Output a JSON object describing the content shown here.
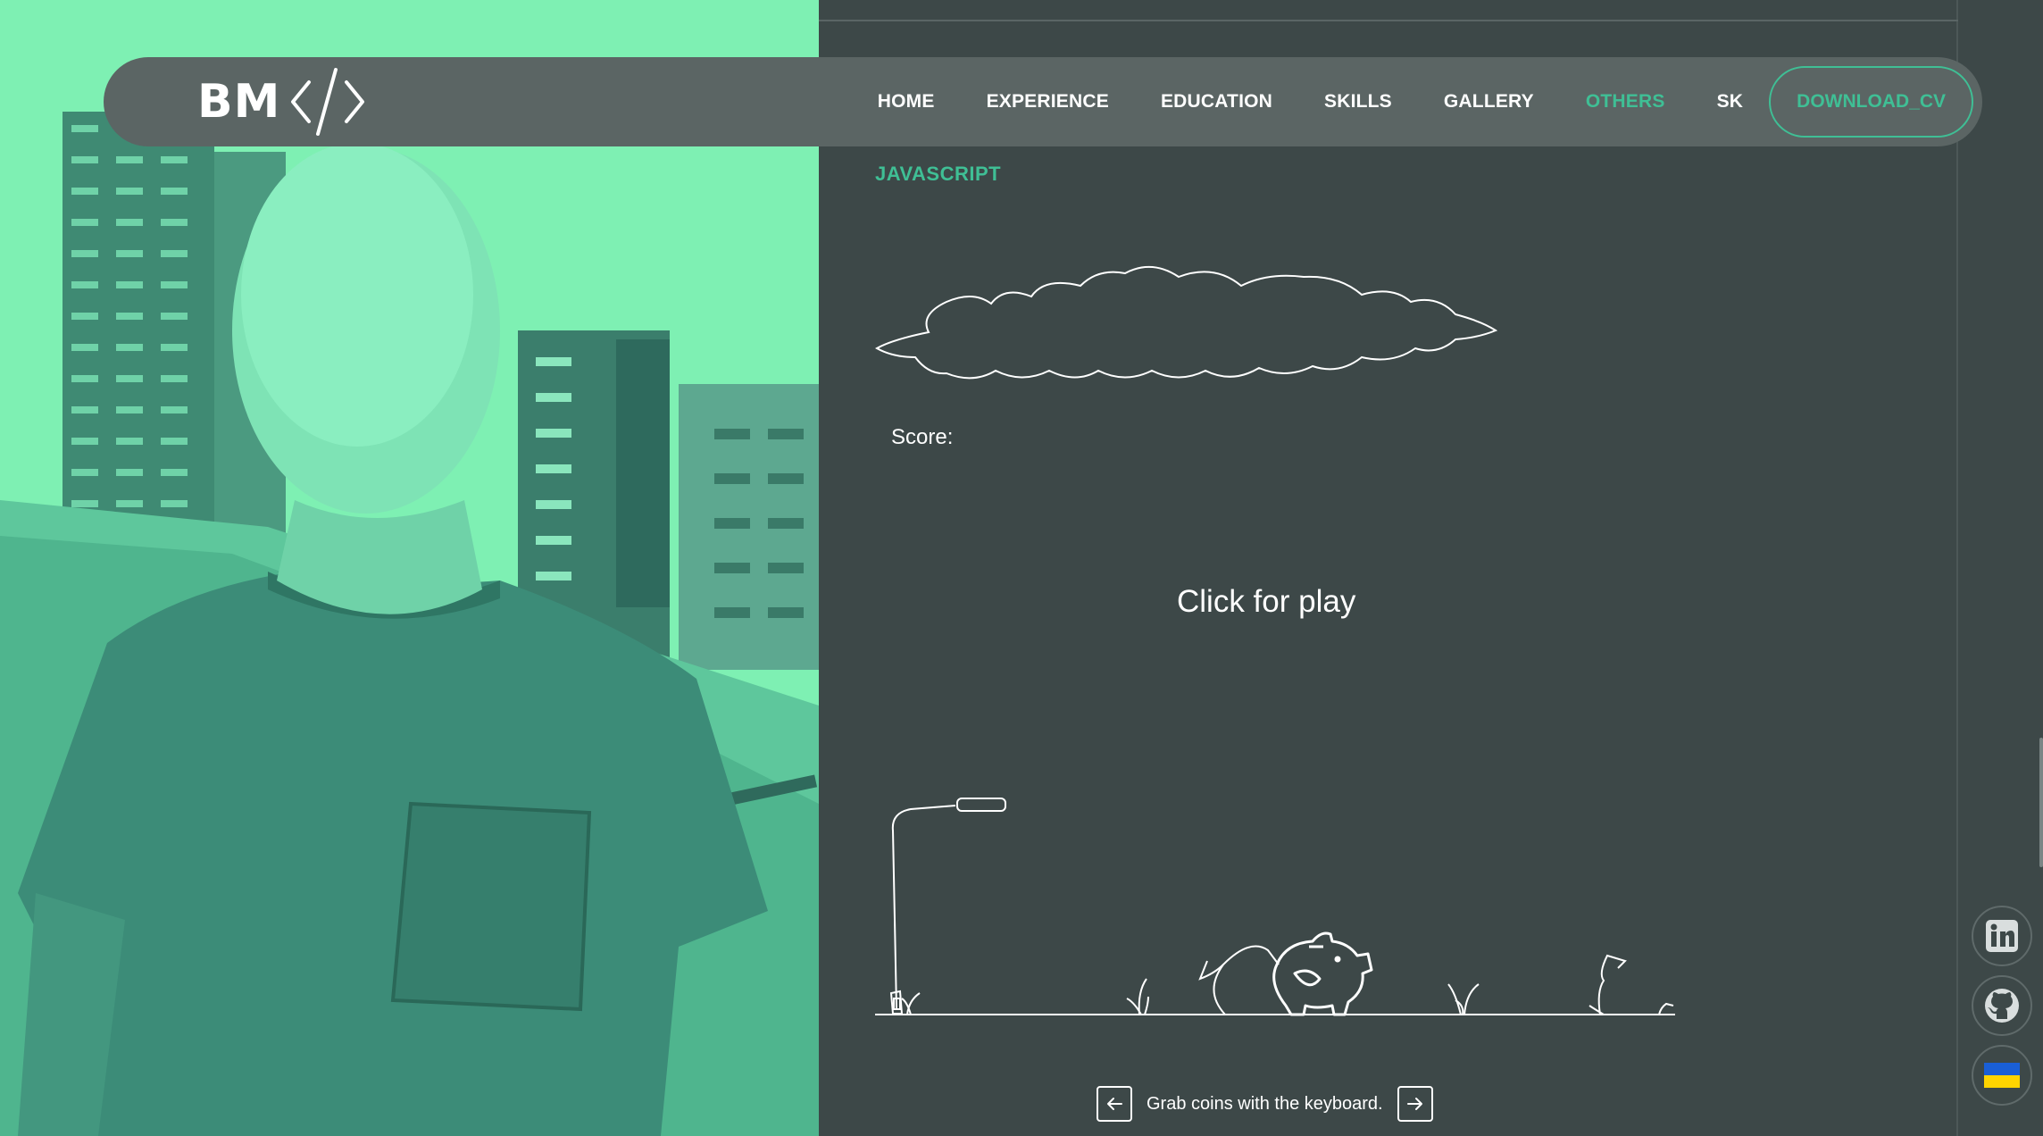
{
  "navbar": {
    "logo_text": "BM",
    "links": [
      {
        "label": "HOME"
      },
      {
        "label": "EXPERIENCE"
      },
      {
        "label": "EDUCATION"
      },
      {
        "label": "SKILLS"
      },
      {
        "label": "GALLERY"
      },
      {
        "label": "OTHERS"
      },
      {
        "label": "SK"
      }
    ],
    "cta_label": "DOWNLOAD_CV"
  },
  "section": {
    "title": "JAVASCRIPT"
  },
  "game": {
    "score_label": "Score:",
    "score_value": "",
    "play_hint": "Click for play",
    "controls_hint": "Grab coins with the keyboard.",
    "left_key_icon": "arrow-left-icon",
    "right_key_icon": "arrow-right-icon"
  },
  "social": [
    {
      "icon": "linkedin-icon"
    },
    {
      "icon": "github-icon"
    },
    {
      "icon": "ukraine-flag-icon"
    }
  ],
  "colors": {
    "accent": "#3fbf95",
    "background": "#3d4848",
    "navbar": "#5b6564",
    "photo_tint": "#7ff0b4"
  }
}
